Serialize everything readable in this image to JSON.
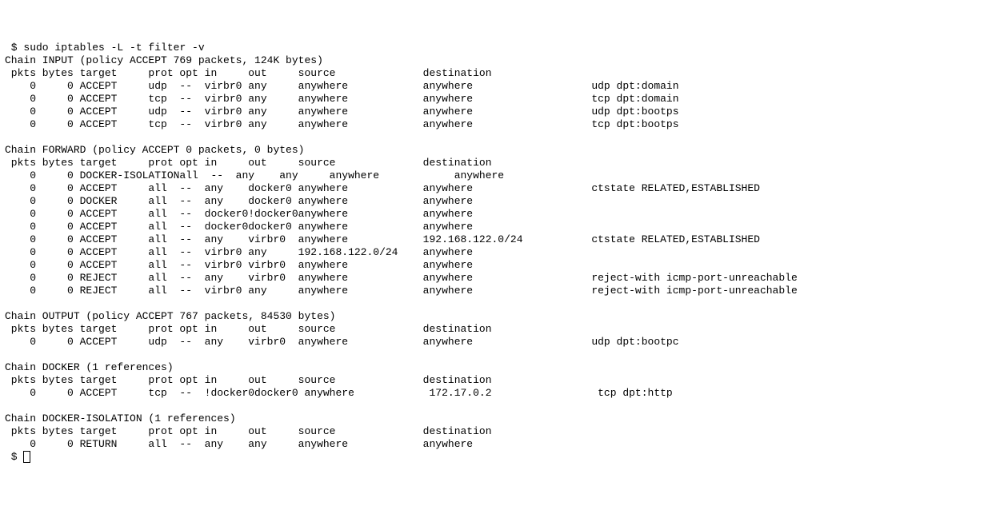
{
  "prompt": " $ ",
  "command": "sudo iptables -L -t filter -v",
  "header_labels": {
    "pkts": "pkts",
    "bytes": "bytes",
    "target": "target",
    "prot": "prot",
    "opt": "opt",
    "in": "in",
    "out": "out",
    "source": "source",
    "destination": "destination"
  },
  "chains": [
    {
      "name": "INPUT",
      "policy_text": "(policy ACCEPT 769 packets, 124K bytes)",
      "rules": [
        {
          "pkts": "0",
          "bytes": "0",
          "target": "ACCEPT",
          "prot": "udp",
          "opt": "--",
          "in": "virbr0",
          "out": "any",
          "source": "anywhere",
          "destination": "anywhere",
          "extra": "udp dpt:domain"
        },
        {
          "pkts": "0",
          "bytes": "0",
          "target": "ACCEPT",
          "prot": "tcp",
          "opt": "--",
          "in": "virbr0",
          "out": "any",
          "source": "anywhere",
          "destination": "anywhere",
          "extra": "tcp dpt:domain"
        },
        {
          "pkts": "0",
          "bytes": "0",
          "target": "ACCEPT",
          "prot": "udp",
          "opt": "--",
          "in": "virbr0",
          "out": "any",
          "source": "anywhere",
          "destination": "anywhere",
          "extra": "udp dpt:bootps"
        },
        {
          "pkts": "0",
          "bytes": "0",
          "target": "ACCEPT",
          "prot": "tcp",
          "opt": "--",
          "in": "virbr0",
          "out": "any",
          "source": "anywhere",
          "destination": "anywhere",
          "extra": "tcp dpt:bootps"
        }
      ]
    },
    {
      "name": "FORWARD",
      "policy_text": "(policy ACCEPT 0 packets, 0 bytes)",
      "rules": [
        {
          "pkts": "0",
          "bytes": "0",
          "target": "DOCKER-ISOLATION",
          "prot": "all",
          "opt": "--",
          "in": "any",
          "out": "any",
          "source": "anywhere",
          "destination": "anywhere",
          "extra": ""
        },
        {
          "pkts": "0",
          "bytes": "0",
          "target": "ACCEPT",
          "prot": "all",
          "opt": "--",
          "in": "any",
          "out": "docker0",
          "source": "anywhere",
          "destination": "anywhere",
          "extra": "ctstate RELATED,ESTABLISHED"
        },
        {
          "pkts": "0",
          "bytes": "0",
          "target": "DOCKER",
          "prot": "all",
          "opt": "--",
          "in": "any",
          "out": "docker0",
          "source": "anywhere",
          "destination": "anywhere",
          "extra": ""
        },
        {
          "pkts": "0",
          "bytes": "0",
          "target": "ACCEPT",
          "prot": "all",
          "opt": "--",
          "in": "docker0",
          "out": "!docker0",
          "source": "anywhere",
          "destination": "anywhere",
          "extra": ""
        },
        {
          "pkts": "0",
          "bytes": "0",
          "target": "ACCEPT",
          "prot": "all",
          "opt": "--",
          "in": "docker0",
          "out": "docker0",
          "source": "anywhere",
          "destination": "anywhere",
          "extra": ""
        },
        {
          "pkts": "0",
          "bytes": "0",
          "target": "ACCEPT",
          "prot": "all",
          "opt": "--",
          "in": "any",
          "out": "virbr0",
          "source": "anywhere",
          "destination": "192.168.122.0/24",
          "extra": "ctstate RELATED,ESTABLISHED"
        },
        {
          "pkts": "0",
          "bytes": "0",
          "target": "ACCEPT",
          "prot": "all",
          "opt": "--",
          "in": "virbr0",
          "out": "any",
          "source": "192.168.122.0/24",
          "destination": "anywhere",
          "extra": ""
        },
        {
          "pkts": "0",
          "bytes": "0",
          "target": "ACCEPT",
          "prot": "all",
          "opt": "--",
          "in": "virbr0",
          "out": "virbr0",
          "source": "anywhere",
          "destination": "anywhere",
          "extra": ""
        },
        {
          "pkts": "0",
          "bytes": "0",
          "target": "REJECT",
          "prot": "all",
          "opt": "--",
          "in": "any",
          "out": "virbr0",
          "source": "anywhere",
          "destination": "anywhere",
          "extra": "reject-with icmp-port-unreachable"
        },
        {
          "pkts": "0",
          "bytes": "0",
          "target": "REJECT",
          "prot": "all",
          "opt": "--",
          "in": "virbr0",
          "out": "any",
          "source": "anywhere",
          "destination": "anywhere",
          "extra": "reject-with icmp-port-unreachable"
        }
      ]
    },
    {
      "name": "OUTPUT",
      "policy_text": "(policy ACCEPT 767 packets, 84530 bytes)",
      "rules": [
        {
          "pkts": "0",
          "bytes": "0",
          "target": "ACCEPT",
          "prot": "udp",
          "opt": "--",
          "in": "any",
          "out": "virbr0",
          "source": "anywhere",
          "destination": "anywhere",
          "extra": "udp dpt:bootpc"
        }
      ]
    },
    {
      "name": "DOCKER",
      "policy_text": "(1 references)",
      "rules": [
        {
          "pkts": "0",
          "bytes": "0",
          "target": "ACCEPT",
          "prot": "tcp",
          "opt": "--",
          "in": "!docker0",
          "out": "docker0",
          "source": "anywhere",
          "destination": "172.17.0.2",
          "extra": "tcp dpt:http"
        }
      ]
    },
    {
      "name": "DOCKER-ISOLATION",
      "policy_text": "(1 references)",
      "rules": [
        {
          "pkts": "0",
          "bytes": "0",
          "target": "RETURN",
          "prot": "all",
          "opt": "--",
          "in": "any",
          "out": "any",
          "source": "anywhere",
          "destination": "anywhere",
          "extra": ""
        }
      ]
    }
  ],
  "final_prompt": " $ "
}
